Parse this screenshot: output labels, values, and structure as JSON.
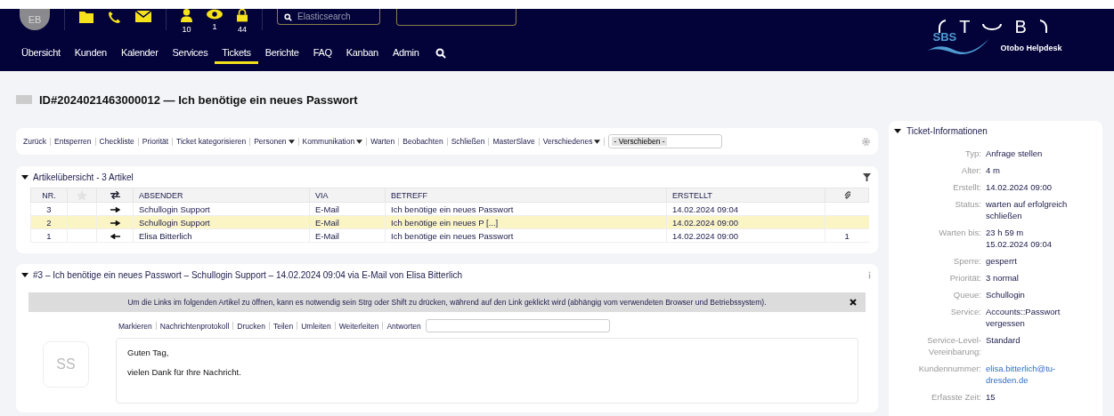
{
  "header": {
    "avatar": "EB",
    "counters": [
      {
        "kind": "user",
        "count": "10"
      },
      {
        "kind": "eye",
        "count": "1"
      },
      {
        "kind": "lock",
        "count": "44"
      }
    ],
    "search": {
      "placeholder": "Elasticsearch"
    },
    "nav": [
      {
        "label": "Übersicht",
        "selected": false
      },
      {
        "label": "Kunden",
        "selected": false
      },
      {
        "label": "Kalender",
        "selected": false
      },
      {
        "label": "Services",
        "selected": false
      },
      {
        "label": "Tickets",
        "selected": true
      },
      {
        "label": "Berichte",
        "selected": false
      },
      {
        "label": "FAQ",
        "selected": false
      },
      {
        "label": "Kanban",
        "selected": false
      },
      {
        "label": "Admin",
        "selected": false
      }
    ],
    "logo": {
      "letters": [
        "T",
        "B"
      ],
      "badge": "SBS",
      "caption": "Otobo Helpdesk"
    }
  },
  "title": "ID#2024021463000012 — Ich benötige ein neues Passwort",
  "actions": [
    {
      "label": "Zurück",
      "dropdown": false
    },
    {
      "label": "Entsperren",
      "dropdown": false
    },
    {
      "label": "Checkliste",
      "dropdown": false
    },
    {
      "label": "Priorität",
      "dropdown": false
    },
    {
      "label": "Ticket kategorisieren",
      "dropdown": false
    },
    {
      "label": "Personen",
      "dropdown": true
    },
    {
      "label": "Kommunikation",
      "dropdown": true
    },
    {
      "label": "Warten",
      "dropdown": false
    },
    {
      "label": "Beobachten",
      "dropdown": false
    },
    {
      "label": "Schließen",
      "dropdown": false
    },
    {
      "label": "MasterSlave",
      "dropdown": false
    },
    {
      "label": "Verschiedenes",
      "dropdown": true
    }
  ],
  "move_select": "- Verschieben -",
  "overview": {
    "title": "Artikelübersicht - 3 Artikel",
    "columns": [
      "NR.",
      "ABSENDER",
      "VIA",
      "BETREFF",
      "ERSTELLT"
    ],
    "rows": [
      {
        "nr": "3",
        "kind": "outgoing",
        "sender": "Schullogin Support",
        "via": "E-Mail",
        "subject": "Ich benötige ein neues Passwort",
        "created": "14.02.2024 09:04",
        "attachments": "",
        "selected": false
      },
      {
        "nr": "2",
        "kind": "outgoing",
        "sender": "Schullogin Support",
        "via": "E-Mail",
        "subject": "Ich benötige ein neues P [...]",
        "created": "14.02.2024 09:00",
        "attachments": "",
        "selected": true
      },
      {
        "nr": "1",
        "kind": "incoming",
        "sender": "Elisa Bitterlich",
        "via": "E-Mail",
        "subject": "Ich benötige ein neues Passwort",
        "created": "14.02.2024 09:00",
        "attachments": "1",
        "selected": false
      }
    ]
  },
  "article": {
    "title": "#3 – Ich benötige ein neues Passwort – Schullogin Support – 14.02.2024 09:04 via E-Mail von Elisa Bitterlich",
    "notice": "Um die Links im folgenden Artikel zu öffnen, kann es notwendig sein Strg oder Shift zu drücken, während auf den Link geklickt wird (abhängig vom verwendeten Browser und Betriebssystem).",
    "actions": [
      "Markieren",
      "Nachrichtenprotokoll",
      "Drucken",
      "Teilen",
      "Umleiten",
      "Weiterleiten",
      "Antworten"
    ],
    "avatar": "SS",
    "body": [
      "Guten Tag,",
      "vielen Dank für Ihre Nachricht."
    ]
  },
  "ticket_info": {
    "title": "Ticket-Informationen",
    "fields": [
      {
        "label": "Typ:",
        "value": [
          "Anfrage stellen"
        ],
        "kind": "text"
      },
      {
        "label": "Alter:",
        "value": [
          "4 m"
        ],
        "kind": "text"
      },
      {
        "label": "Erstellt:",
        "value": [
          "14.02.2024 09:00"
        ],
        "kind": "text"
      },
      {
        "label": "Status:",
        "value": [
          "warten auf erfolgreich",
          "schließen"
        ],
        "kind": "text"
      },
      {
        "label": "Warten bis:",
        "value": [
          "23 h 59 m",
          "15.02.2024 09:04"
        ],
        "kind": "text"
      },
      {
        "label": "Sperre:",
        "value": [
          "gesperrt"
        ],
        "kind": "text"
      },
      {
        "label": "Priorität:",
        "value": [
          "3 normal"
        ],
        "kind": "text"
      },
      {
        "label": "Queue:",
        "value": [
          "Schullogin"
        ],
        "kind": "text"
      },
      {
        "label": "Service:",
        "value": [
          "Accounts::Passwort",
          "vergessen"
        ],
        "kind": "text"
      },
      {
        "label": "Service-Level-Vereinbarung:",
        "value": [
          "Standard"
        ],
        "kind": "text"
      },
      {
        "label": "Kundennummer:",
        "value": [
          "elisa.bitterlich@tu-",
          "dresden.de"
        ],
        "kind": "link"
      },
      {
        "label": "Erfasste Zeit:",
        "value": [
          "15"
        ],
        "kind": "text"
      }
    ]
  }
}
